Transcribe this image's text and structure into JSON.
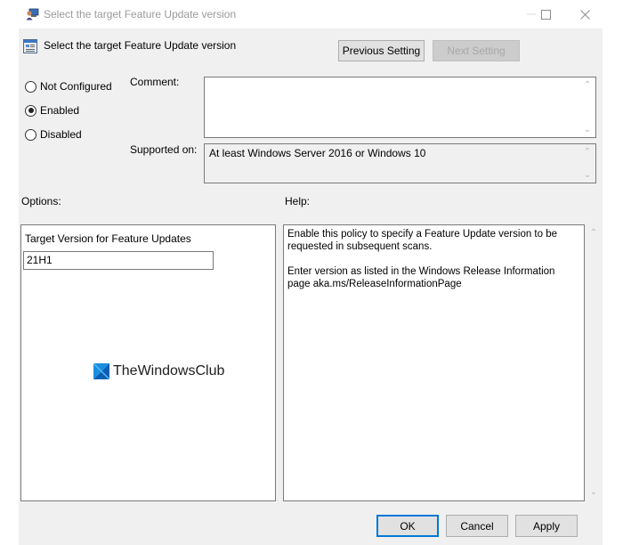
{
  "window": {
    "title": "Select the target Feature Update version",
    "controls": {
      "minimize": "—",
      "maximize": "☐",
      "close": "✕"
    }
  },
  "header": {
    "title": "Select the target Feature Update version",
    "prev_button": "Previous Setting",
    "next_button": "Next Setting",
    "next_disabled": true
  },
  "state": {
    "options": [
      {
        "label": "Not Configured",
        "checked": false
      },
      {
        "label": "Enabled",
        "checked": true
      },
      {
        "label": "Disabled",
        "checked": false
      }
    ]
  },
  "comment": {
    "label": "Comment:",
    "value": ""
  },
  "supported": {
    "label": "Supported on:",
    "value": "At least Windows Server 2016 or Windows 10"
  },
  "options_section": {
    "label": "Options:",
    "field_label": "Target Version for Feature Updates",
    "field_value": "21H1"
  },
  "help_section": {
    "label": "Help:",
    "text": "Enable this policy to specify a Feature Update version to be requested in subsequent scans.\n\nEnter version as listed in the Windows Release Information page aka.ms/ReleaseInformationPage"
  },
  "watermark": {
    "text": "TheWindowsClub"
  },
  "footer": {
    "ok": "OK",
    "cancel": "Cancel",
    "apply": "Apply"
  },
  "colors": {
    "accent": "#0078d7",
    "dialog_bg": "#f0f0f0",
    "border": "#7a7a7a"
  }
}
